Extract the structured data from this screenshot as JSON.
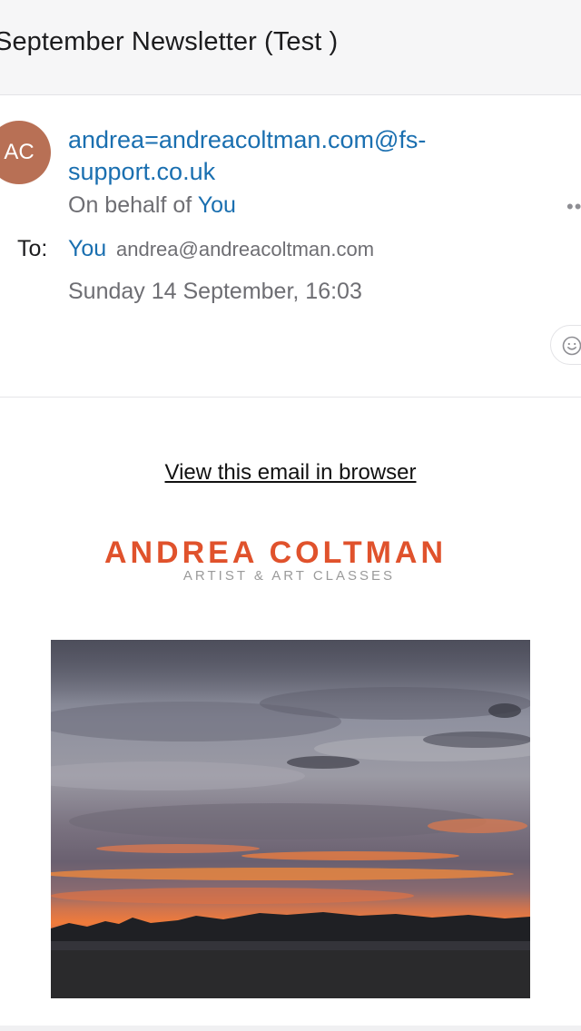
{
  "email": {
    "subject": "September Newsletter (Test )",
    "sender_initials": "AC",
    "from_address": "andrea=andreacoltman.com@fs-support.co.uk",
    "on_behalf_prefix": "On behalf of",
    "on_behalf_name": "You",
    "to_label": "To:",
    "to_name": "You",
    "to_address": "andrea@andreacoltman.com",
    "date": "Sunday 14 September, 16:03",
    "more_icon": "ellipsis-icon",
    "reaction_icon": "smiley-icon"
  },
  "body": {
    "view_in_browser": "View this email in browser",
    "logo_title": "ANDREA COLTMAN",
    "logo_subtitle": "ARTIST & ART CLASSES"
  },
  "colors": {
    "link": "#1a6fb0",
    "avatar": "#b87055",
    "logo": "#e0522c"
  }
}
